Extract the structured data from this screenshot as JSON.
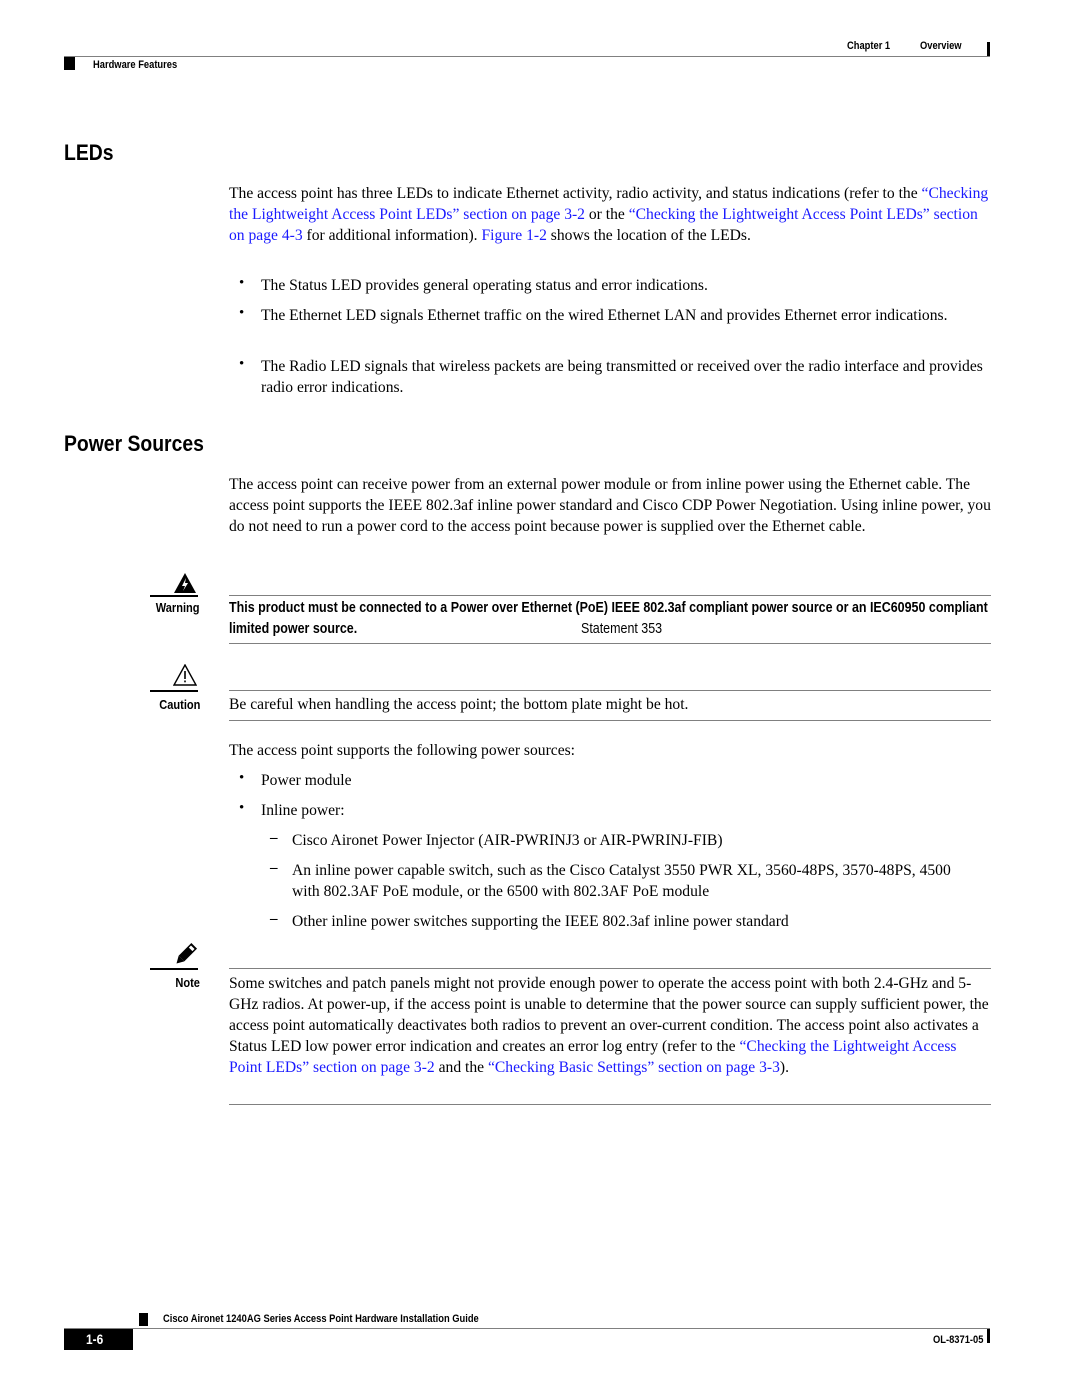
{
  "header": {
    "chapter": "Chapter 1",
    "chapter_title": "Overview",
    "section": "Hardware Features"
  },
  "leds": {
    "heading": "LEDs",
    "intro": {
      "t1": "The access point has three LEDs to indicate Ethernet activity, radio activity, and status indications (refer to the ",
      "link1": "“Checking the Lightweight Access Point LEDs” section on page 3-2",
      "t2": " or the ",
      "link2": "“Checking the Lightweight Access Point LEDs” section on page 4-3",
      "t3": " for additional information). ",
      "link3": "Figure 1-2",
      "t4": " shows the location of the LEDs."
    },
    "bullets": [
      "The Status LED provides general operating status and error indications.",
      "The Ethernet LED signals Ethernet traffic on the wired Ethernet LAN and provides Ethernet error indications.",
      "The Radio LED signals that wireless packets are being transmitted or received over the radio interface and provides radio error indications."
    ],
    "bullet_glyph": "•"
  },
  "power": {
    "heading": "Power Sources",
    "intro": "The access point can receive power from an external power module or from inline power using the Ethernet cable. The access point supports the IEEE 802.3af inline power standard and Cisco CDP Power Negotiation. Using inline power, you do not need to run a power cord to the access point because power is supplied over the Ethernet cable.",
    "warning": {
      "label": "Warning",
      "bold": "This product must be connected to a Power over Ethernet (PoE) IEEE 802.3af compliant power source or an IEC60950 compliant limited power source.",
      "statement": " Statement 353"
    },
    "caution": {
      "label": "Caution",
      "text": "Be careful when handling the access point; the bottom plate might be hot."
    },
    "supports": "The access point supports the following power sources:",
    "sources": [
      "Power module",
      "Inline power:"
    ],
    "inline": [
      "Cisco Aironet Power Injector (AIR-PWRINJ3 or AIR-PWRINJ-FIB)",
      "An inline power capable switch, such as the Cisco Catalyst 3550 PWR XL, 3560-48PS, 3570-48PS, 4500 with 802.3AF PoE module, or the 6500 with 802.3AF PoE module",
      "Other inline power switches supporting the IEEE 802.3af inline power standard"
    ],
    "dash_glyph": "–",
    "note": {
      "label": "Note",
      "t1": "Some switches and patch panels might not provide enough power to operate the access point with both 2.4-GHz and 5-GHz radios. At power-up, if the access point is unable to determine that the power source can supply sufficient power, the access point automatically deactivates both radios to prevent an over-current condition. The access point also activates a Status LED low power error indication and creates an error log entry (refer to the ",
      "link1": "“Checking the Lightweight Access Point LEDs” section on page 3-2",
      "t2": " and the ",
      "link2": "“Checking Basic Settings” section on page 3-3",
      "t3": ")."
    }
  },
  "footer": {
    "guide_title": "Cisco Aironet 1240AG Series Access Point Hardware Installation Guide",
    "page_number": "1-6",
    "doc_id": "OL-8371-05"
  }
}
